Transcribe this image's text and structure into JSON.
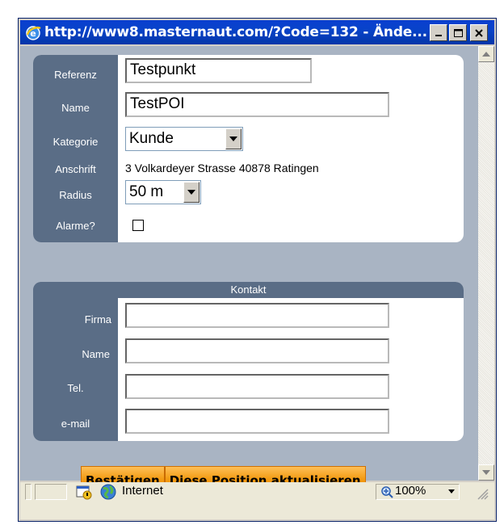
{
  "window": {
    "title": "http://www8.masternaut.com/?Code=132 - Ände...",
    "title_color": "#ffffff",
    "titlebar_color": "#0843c9"
  },
  "form": {
    "referenz": {
      "label": "Referenz",
      "value": "Testpunkt"
    },
    "name": {
      "label": "Name",
      "value": "TestPOI"
    },
    "kategorie": {
      "label": "Kategorie",
      "value": "Kunde"
    },
    "anschrift": {
      "label": "Anschrift",
      "value": "3 Volkardeyer Strasse 40878 Ratingen"
    },
    "radius": {
      "label": "Radius",
      "value": "50 m"
    },
    "alarme": {
      "label": "Alarme?",
      "checked": false
    }
  },
  "kontakt": {
    "title": "Kontakt",
    "firma": {
      "label": "Firma",
      "value": ""
    },
    "name": {
      "label": "Name",
      "value": ""
    },
    "tel": {
      "label": "Tel.",
      "value": ""
    },
    "email": {
      "label": "e-mail",
      "value": ""
    }
  },
  "actions": {
    "confirm_label": "Bestätigen",
    "update_position_label": "Diese Position aktualisieren",
    "accent": "#f29a12"
  },
  "statusbar": {
    "zone": "Internet",
    "zoom": "100%"
  },
  "icons": [
    "ie-icon",
    "minimize-icon",
    "maximize-icon",
    "close-icon",
    "dropdown-arrow-icon",
    "scroll-up-icon",
    "scroll-down-icon",
    "security-lock-icon",
    "globe-icon",
    "zoom-icon",
    "resize-grip-icon"
  ]
}
